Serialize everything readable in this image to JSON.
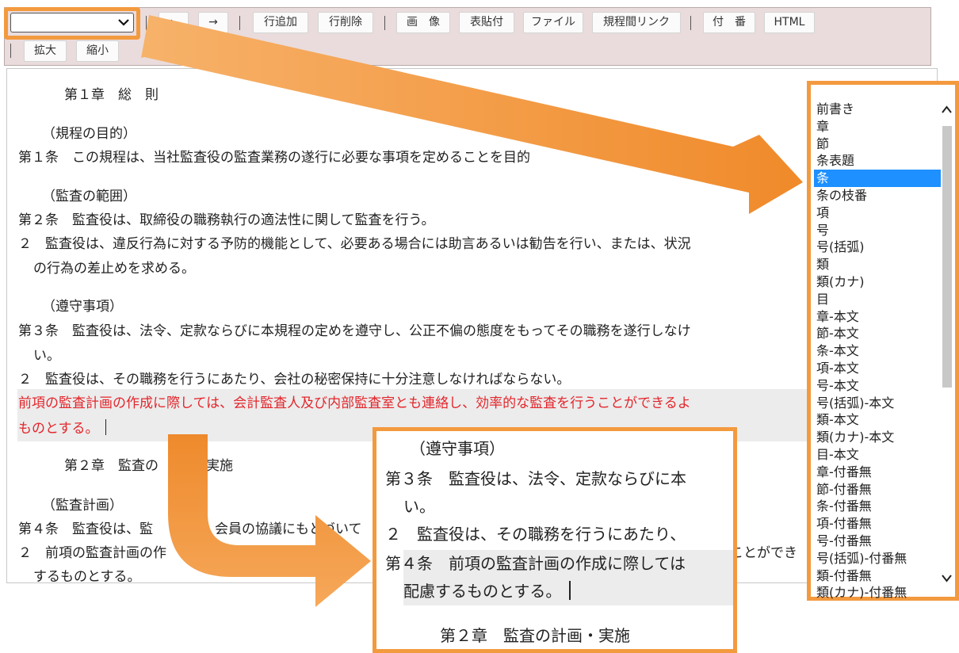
{
  "toolbar": {
    "style_select_value": "",
    "buttons": [
      "←",
      "→",
      "行追加",
      "行削除",
      "画　像",
      "表貼付",
      "ファイル",
      "規程間リンク",
      "付　番",
      "HTML",
      "拡大",
      "縮小"
    ]
  },
  "document": {
    "lines": [
      "第１章　総　則",
      "（規程の目的）",
      "第１条　この規程は、当社監査役の監査業務の遂行に必要な事項を定めることを目的",
      "（監査の範囲）",
      "第２条　監査役は、取締役の職務執行の適法性に関して監査を行う。",
      "２　監査役は、違反行為に対する予防的機能として、必要ある場合には助言あるいは勧告を行い、または、状況",
      "の行為の差止めを求める。",
      "（遵守事項）",
      "第３条　監査役は、法令、定款ならびに本規程の定めを遵守し、公正不偏の態度をもってその職務を遂行しなけ",
      "い。",
      "２　監査役は、その職務を行うにあたり、会社の秘密保持に十分注意しなければならない。",
      "前項の監査計画の作成に際しては、会計監査人及び内部監査室とも連絡し、効率的な監査を行うことができるよ",
      "ものとする。",
      "第２章　監査の",
      "・実施",
      "（監査計画）",
      "第４条　監査役は、監",
      "会員の協議にもとづいて",
      "２　前項の監査計画の作",
      "ことができ",
      "するものとする。"
    ]
  },
  "style_list": {
    "options": [
      "前書き",
      "章",
      "節",
      "条表題",
      "条",
      "条の枝番",
      "項",
      "号",
      "号(括弧)",
      "類",
      "類(カナ)",
      "目",
      "章-本文",
      "節-本文",
      "条-本文",
      "項-本文",
      "号-本文",
      "号(括弧)-本文",
      "類-本文",
      "類(カナ)-本文",
      "目-本文",
      "章-付番無",
      "節-付番無",
      "条-付番無",
      "項-付番無",
      "号-付番無",
      "号(括弧)-付番無",
      "類-付番無",
      "類(カナ)-付番無"
    ],
    "selected_index": 4
  },
  "zoom": {
    "lines": [
      "（遵守事項）",
      "第３条　監査役は、法令、定款ならびに本",
      "い。",
      "２　監査役は、その職務を行うにあたり、",
      "第４条　前項の監査計画の作成に際しては",
      "配慮するものとする。",
      "第２章　監査の計画・実施"
    ]
  },
  "colors": {
    "accent": "#f39a3f",
    "red_text": "#e3262c",
    "toolbar_bg": "#eadcdc",
    "selected": "#1e90ff"
  }
}
